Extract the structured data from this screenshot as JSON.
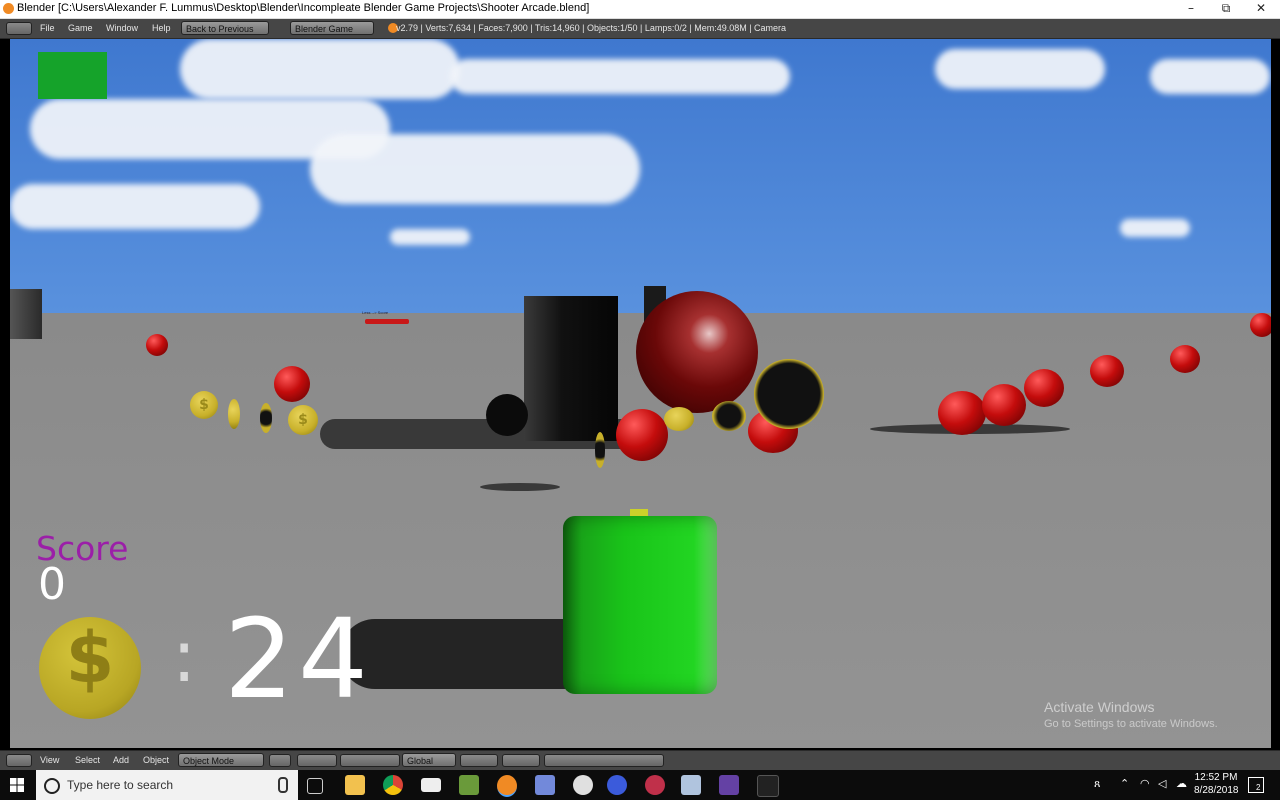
{
  "window": {
    "title": "Blender [C:\\Users\\Alexander F. Lummus\\Desktop\\Blender\\Incompleate Blender Game Projects\\Shooter Arcade.blend]",
    "minimize": "–",
    "maximize": "⧉",
    "close": "✕"
  },
  "header": {
    "menus": [
      "File",
      "Game",
      "Window",
      "Help"
    ],
    "back_button": "Back to Previous",
    "engine": "Blender Game",
    "stats": "v2.79 | Verts:7,634 | Faces:7,900 | Tris:14,960 | Objects:1/50 | Lamps:0/2 | Mem:49.08M | Camera"
  },
  "hud": {
    "score_label": "Score",
    "score_value": "0",
    "coin_symbol": "$",
    "separator": ":",
    "coin_count": "24",
    "tiny_label": "Less --> Score"
  },
  "footer": {
    "menus": [
      "View",
      "Select",
      "Add",
      "Object"
    ],
    "mode": "Object Mode",
    "orientation": "Global"
  },
  "watermark": {
    "line1": "Activate Windows",
    "line2": "Go to Settings to activate Windows."
  },
  "taskbar": {
    "search_placeholder": "Type here to search",
    "time": "12:52 PM",
    "date": "8/28/2018",
    "notifications": "2"
  },
  "colors": {
    "score_label": "#9b1fa8",
    "cube": "#19c419",
    "hud_square": "#15a32a"
  }
}
